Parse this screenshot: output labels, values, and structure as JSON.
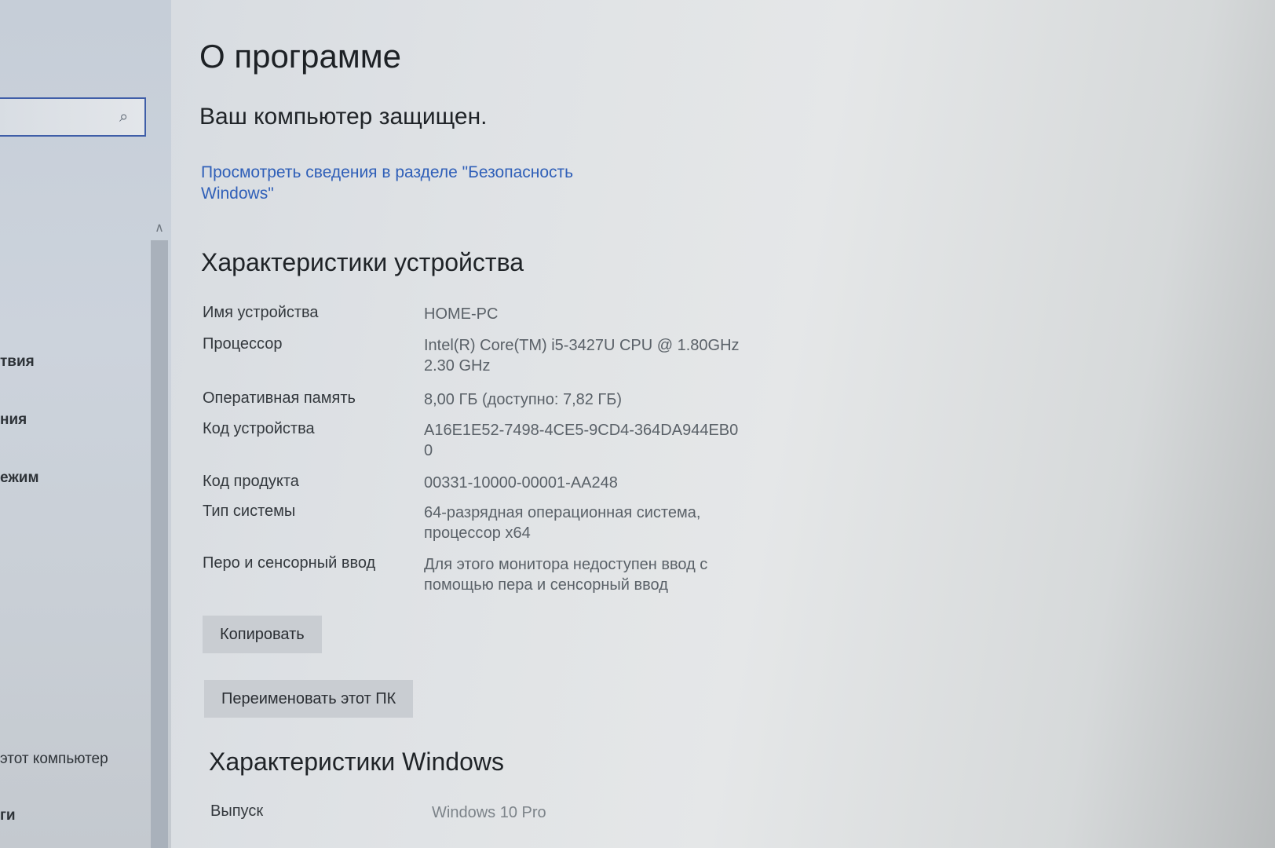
{
  "sidebar": {
    "search_placeholder": "",
    "items": [
      {
        "label": "твия"
      },
      {
        "label": "ния"
      },
      {
        "label": "ежим"
      },
      {
        "label": "этот компьютер"
      },
      {
        "label": "ги"
      }
    ]
  },
  "main": {
    "title": "О программе",
    "protection_status": "Ваш компьютер защищен.",
    "security_link": "Просмотреть сведения в разделе \"Безопасность Windows\"",
    "device_section": {
      "title": "Характеристики устройства",
      "rows": [
        {
          "label": "Имя устройства",
          "value": "HOME-PC"
        },
        {
          "label": "Процессор",
          "value": "Intel(R) Core(TM) i5-3427U CPU @ 1.80GHz 2.30 GHz"
        },
        {
          "label": "Оперативная память",
          "value": "8,00 ГБ (доступно: 7,82 ГБ)"
        },
        {
          "label": "Код устройства",
          "value": "A16E1E52-7498-4CE5-9CD4-364DA944EB0 0"
        },
        {
          "label": "Код продукта",
          "value": "00331-10000-00001-AA248"
        },
        {
          "label": "Тип системы",
          "value": "64-разрядная операционная система, процессор x64"
        },
        {
          "label": "Перо и сенсорный ввод",
          "value": "Для этого монитора недоступен ввод с помощью пера и сенсорный ввод"
        }
      ],
      "copy_button": "Копировать",
      "rename_button": "Переименовать этот ПК"
    },
    "windows_section": {
      "title": "Характеристики Windows",
      "rows": [
        {
          "label": "Выпуск",
          "value": "Windows 10 Pro"
        }
      ]
    }
  },
  "colors": {
    "link": "#2f5fb8",
    "search_border": "#3f5ea8"
  }
}
